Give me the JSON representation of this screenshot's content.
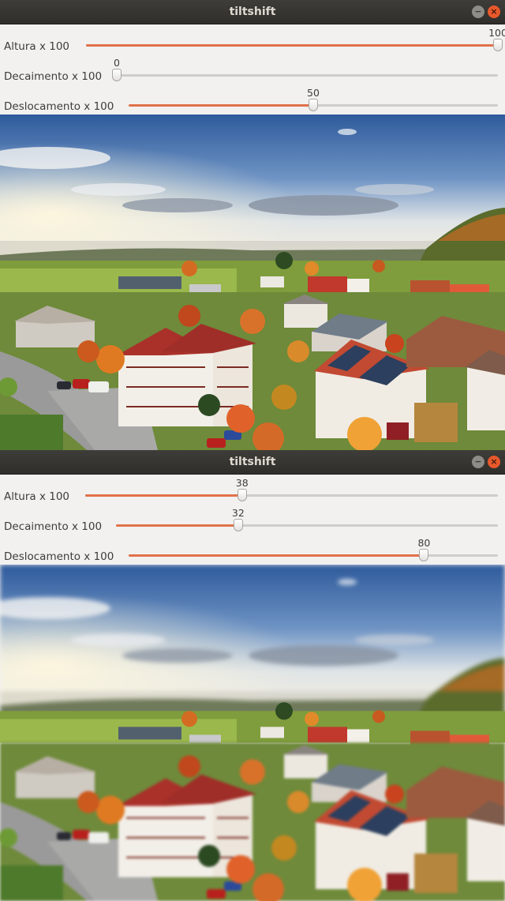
{
  "windows": [
    {
      "title": "tiltshift",
      "sliders": [
        {
          "label": "Altura x 100",
          "value": "100",
          "fraction": 1.0
        },
        {
          "label": "Decaimento x 100",
          "value": "0",
          "fraction": 0.0
        },
        {
          "label": "Deslocamento x 100",
          "value": "50",
          "fraction": 0.5
        }
      ]
    },
    {
      "title": "tiltshift",
      "sliders": [
        {
          "label": "Altura x 100",
          "value": "38",
          "fraction": 0.38
        },
        {
          "label": "Decaimento x 100",
          "value": "32",
          "fraction": 0.32
        },
        {
          "label": "Deslocamento x 100",
          "value": "80",
          "fraction": 0.8
        }
      ]
    }
  ],
  "icons": {
    "minimize": "minimize-icon",
    "close": "close-icon"
  },
  "colors": {
    "accent": "#e0714a",
    "titlebar": "#35342f",
    "window_bg": "#f2f1f0"
  }
}
